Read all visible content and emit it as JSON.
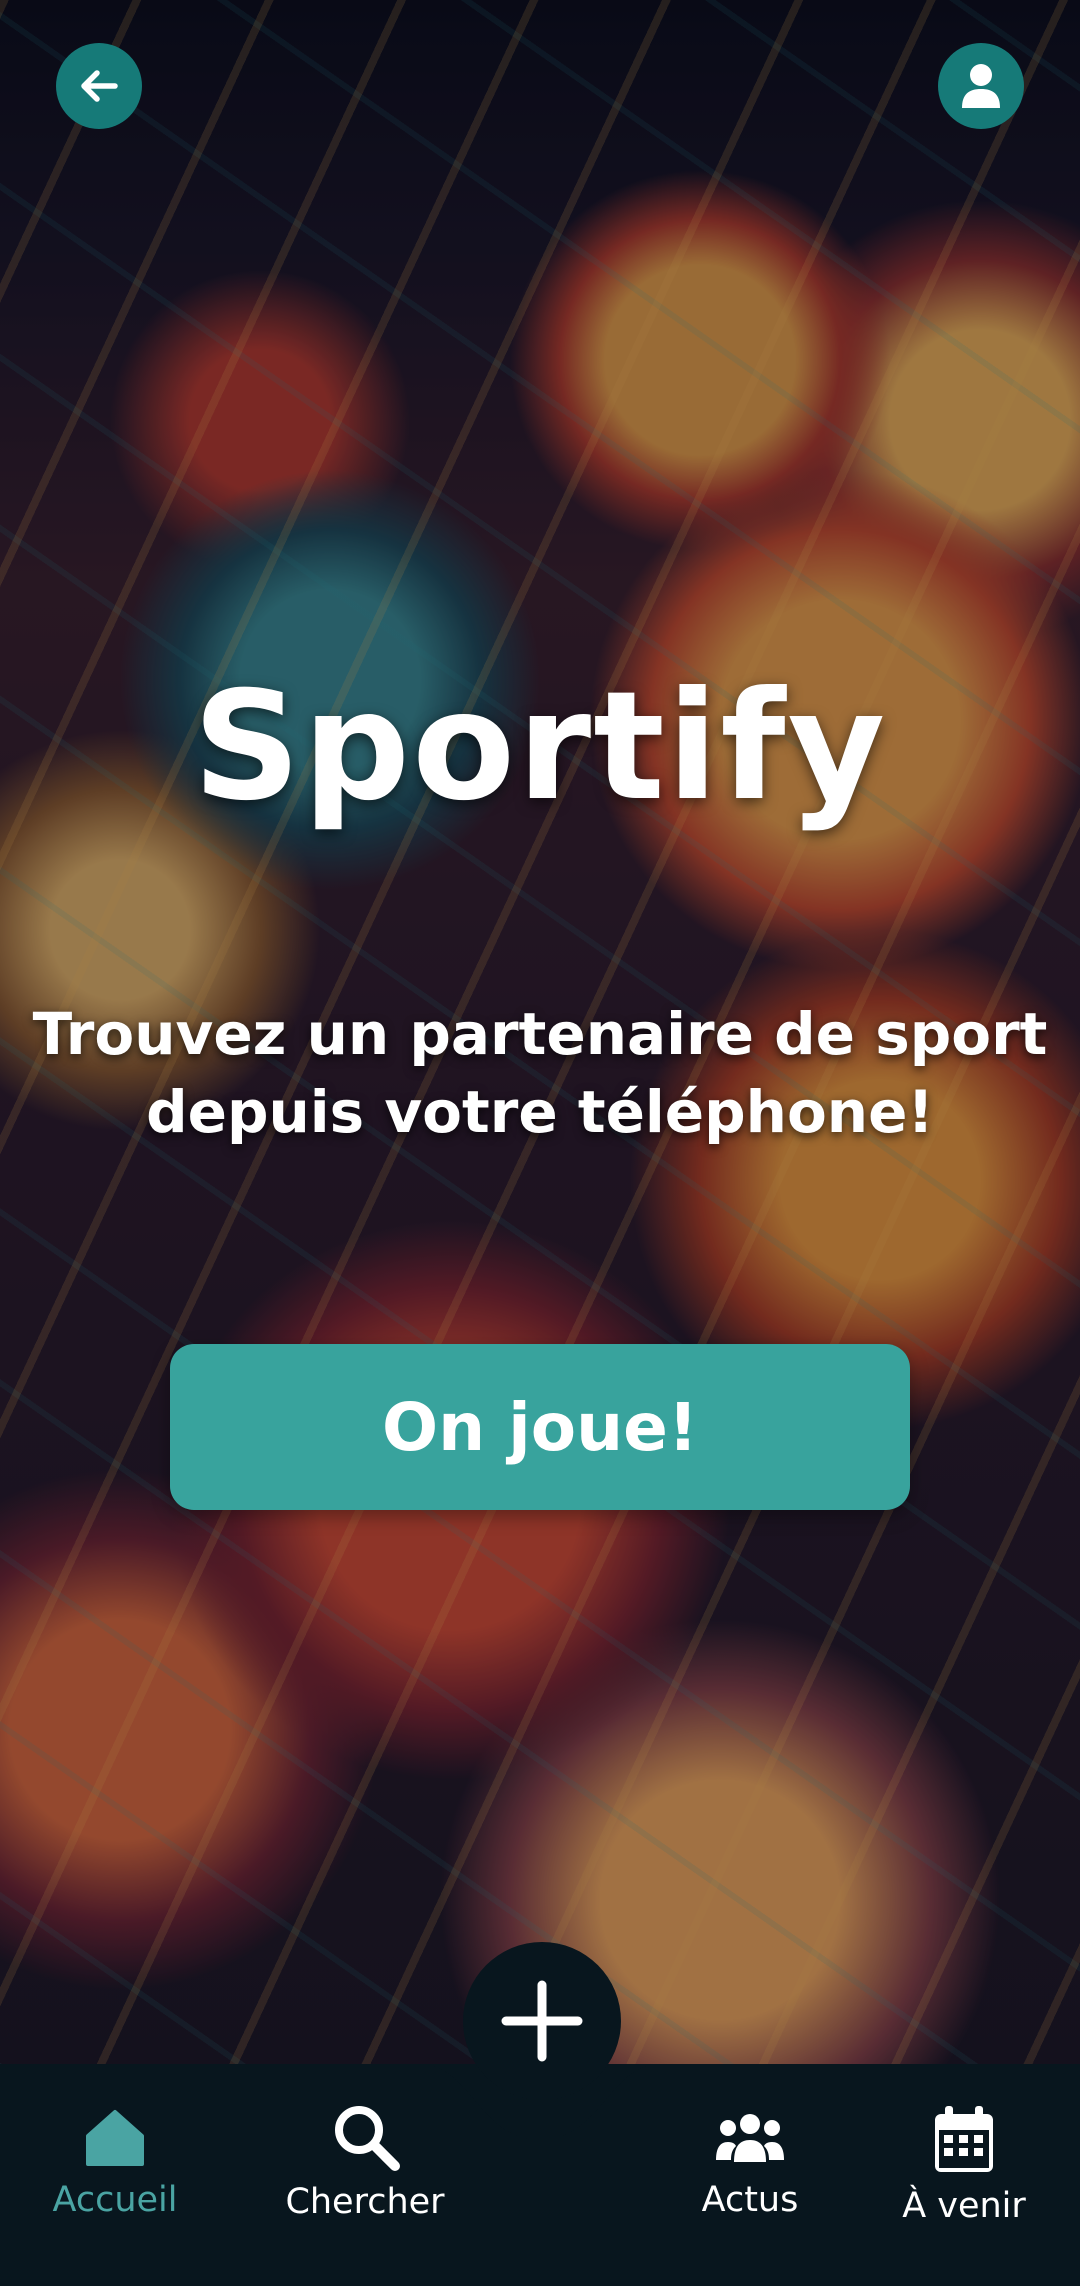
{
  "header": {
    "back_icon": "arrow-left-icon",
    "profile_icon": "user-icon",
    "accent_color": "#167a78"
  },
  "hero": {
    "title": "Sportify",
    "subtitle": "Trouvez un partenaire de sport depuis votre téléphone!",
    "cta_label": "On joue!",
    "cta_color": "#38a39d"
  },
  "nav": {
    "fab_icon": "plus-icon",
    "items": [
      {
        "label": "Accueil",
        "icon": "home-icon",
        "active": true,
        "color": "#4aa4a3"
      },
      {
        "label": "Chercher",
        "icon": "search-icon",
        "active": false
      },
      {
        "label": "Actus",
        "icon": "users-icon",
        "active": false
      },
      {
        "label": "À venir",
        "icon": "calendar-icon",
        "active": false
      }
    ],
    "background": "#08161e"
  }
}
